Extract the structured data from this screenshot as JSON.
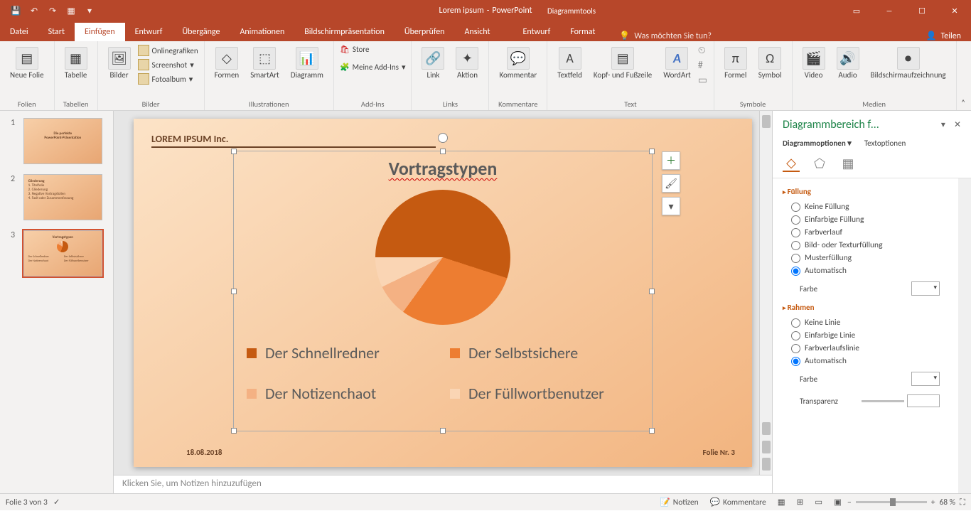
{
  "titlebar": {
    "doc_title": "Lorem ipsum",
    "app_name": "PowerPoint",
    "tool_context": "Diagrammtools"
  },
  "tabs": {
    "file": "Datei",
    "start": "Start",
    "insert": "Einfügen",
    "design": "Entwurf",
    "transitions": "Übergänge",
    "animations": "Animationen",
    "slideshow": "Bildschirmpräsentation",
    "review": "Überprüfen",
    "view": "Ansicht",
    "chart_design": "Entwurf",
    "format": "Format",
    "tellme": "Was möchten Sie tun?",
    "share": "Teilen"
  },
  "ribbon": {
    "new_slide": "Neue Folie",
    "table": "Tabelle",
    "pictures": "Bilder",
    "online_pics": "Onlinegrafiken",
    "screenshot": "Screenshot",
    "photo_album": "Fotoalbum",
    "shapes": "Formen",
    "smartart": "SmartArt",
    "chart": "Diagramm",
    "store": "Store",
    "my_addins": "Meine Add-Ins",
    "link": "Link",
    "action": "Aktion",
    "comment": "Kommentar",
    "textbox": "Textfeld",
    "header_footer": "Kopf- und Fußzeile",
    "wordart": "WordArt",
    "equation": "Formel",
    "symbol": "Symbol",
    "video": "Video",
    "audio": "Audio",
    "screen_rec": "Bildschirmaufzeichnung",
    "grp_slides": "Folien",
    "grp_tables": "Tabellen",
    "grp_images": "Bilder",
    "grp_illustrations": "Illustrationen",
    "grp_addins": "Add-Ins",
    "grp_links": "Links",
    "grp_comments": "Kommentare",
    "grp_text": "Text",
    "grp_symbols": "Symbole",
    "grp_media": "Medien"
  },
  "slide": {
    "company": "LOREM IPSUM Inc.",
    "date": "18.08.2018",
    "footer_num": "Folie Nr. 3",
    "chart_title": "Vortragstypen"
  },
  "chart_data": {
    "type": "pie",
    "title": "Vortragstypen",
    "categories": [
      "Der Schnellredner",
      "Der Selbstsichere",
      "Der Notizenchaot",
      "Der Füllwortbenutzer"
    ],
    "values": [
      55,
      30,
      8,
      7
    ],
    "colors": [
      "#c55a11",
      "#ed7d31",
      "#f4b183",
      "#fad5b4"
    ]
  },
  "notes_placeholder": "Klicken Sie, um Notizen hinzuzufügen",
  "format_pane": {
    "title": "Diagrammbereich f…",
    "opt_chart": "Diagrammoptionen",
    "opt_text": "Textoptionen",
    "fill": "Füllung",
    "fill_none": "Keine Füllung",
    "fill_solid": "Einfarbige Füllung",
    "fill_gradient": "Farbverlauf",
    "fill_picture": "Bild- oder Texturfüllung",
    "fill_pattern": "Musterfüllung",
    "fill_auto": "Automatisch",
    "color": "Farbe",
    "border": "Rahmen",
    "line_none": "Keine Linie",
    "line_solid": "Einfarbige Linie",
    "line_gradient": "Farbverlaufslinie",
    "line_auto": "Automatisch",
    "transparency": "Transparenz"
  },
  "statusbar": {
    "slide_of": "Folie 3 von 3",
    "notes": "Notizen",
    "comments": "Kommentare",
    "zoom": "68 %"
  },
  "thumbs": {
    "t1_a": "Die perfekte",
    "t1_b": "PowerPoint-Präsentation",
    "t2_title": "Gliederung",
    "t2_l1": "1. Titelfolie",
    "t2_l2": "2. Gliederung",
    "t2_l3": "3. Negative Vortragsfolien",
    "t2_l4": "4. Fazit oder Zusammenfassung",
    "t3_title": "Vortragstypen"
  }
}
